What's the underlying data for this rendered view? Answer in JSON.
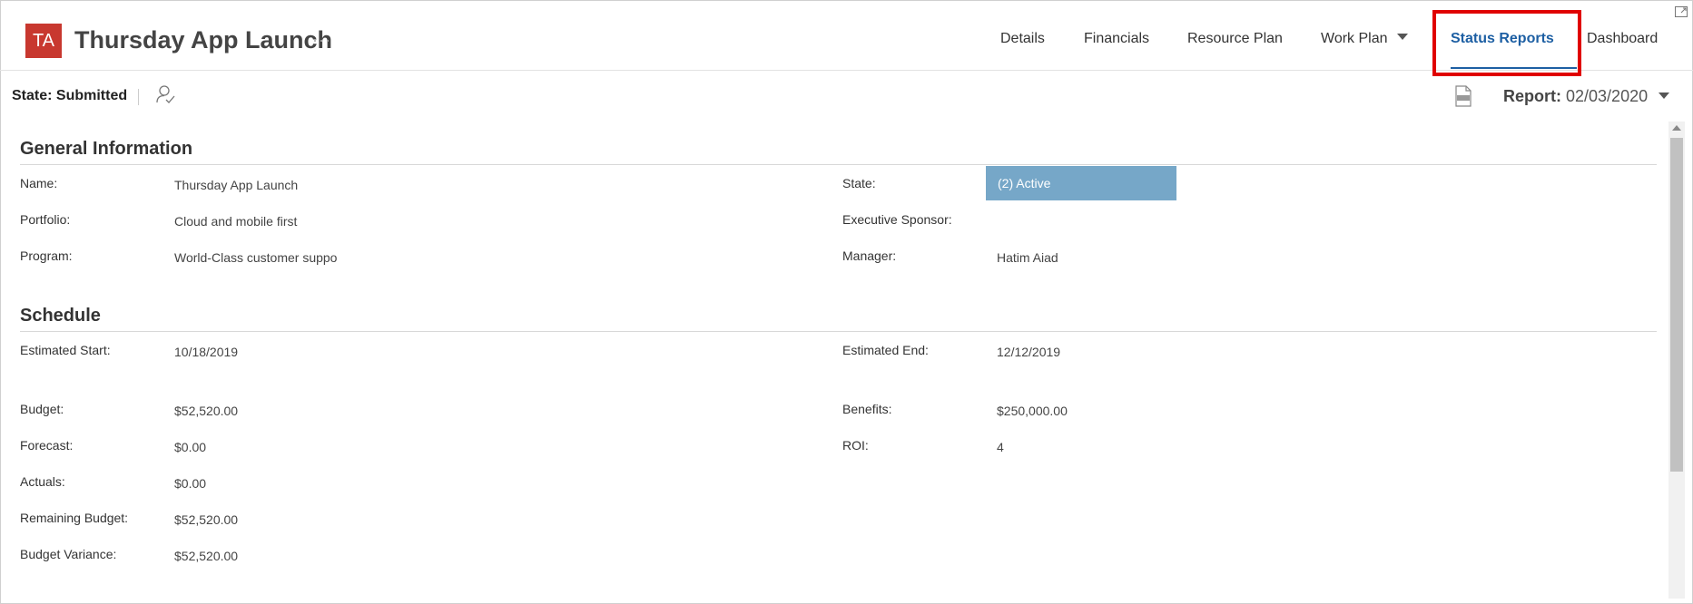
{
  "project": {
    "initials": "TA",
    "title": "Thursday App Launch",
    "more": "···"
  },
  "nav": {
    "details": "Details",
    "financials": "Financials",
    "resource_plan": "Resource Plan",
    "work_plan": "Work Plan",
    "status_reports": "Status Reports",
    "dashboard": "Dashboard"
  },
  "subbar": {
    "state": "State: Submitted",
    "report_label": "Report:",
    "report_date": "02/03/2020"
  },
  "general": {
    "title": "General Information",
    "name_label": "Name:",
    "name_value": "Thursday App Launch",
    "portfolio_label": "Portfolio:",
    "portfolio_value": "Cloud and mobile first",
    "program_label": "Program:",
    "program_value": "World-Class customer suppo",
    "state_label": "State:",
    "state_value": "(2) Active",
    "sponsor_label": "Executive Sponsor:",
    "sponsor_value": "",
    "manager_label": "Manager:",
    "manager_value": "Hatim Aiad"
  },
  "schedule": {
    "title": "Schedule",
    "est_start_label": "Estimated Start:",
    "est_start_value": "10/18/2019",
    "est_end_label": "Estimated End:",
    "est_end_value": "12/12/2019",
    "budget_label": "Budget:",
    "budget_value": "$52,520.00",
    "forecast_label": "Forecast:",
    "forecast_value": "$0.00",
    "actuals_label": "Actuals:",
    "actuals_value": "$0.00",
    "remaining_label": "Remaining Budget:",
    "remaining_value": "$52,520.00",
    "variance_label": "Budget Variance:",
    "variance_value": "$52,520.00",
    "benefits_label": "Benefits:",
    "benefits_value": "$250,000.00",
    "roi_label": "ROI:",
    "roi_value": "4"
  },
  "colors": {
    "avatar": "#c8382f",
    "active_tab": "#1d5fa3",
    "state_badge": "#76a7c8",
    "highlight": "#e00000"
  },
  "icons": [
    "expand-icon",
    "person-check-icon",
    "pdf-icon",
    "chevron-down-icon"
  ]
}
